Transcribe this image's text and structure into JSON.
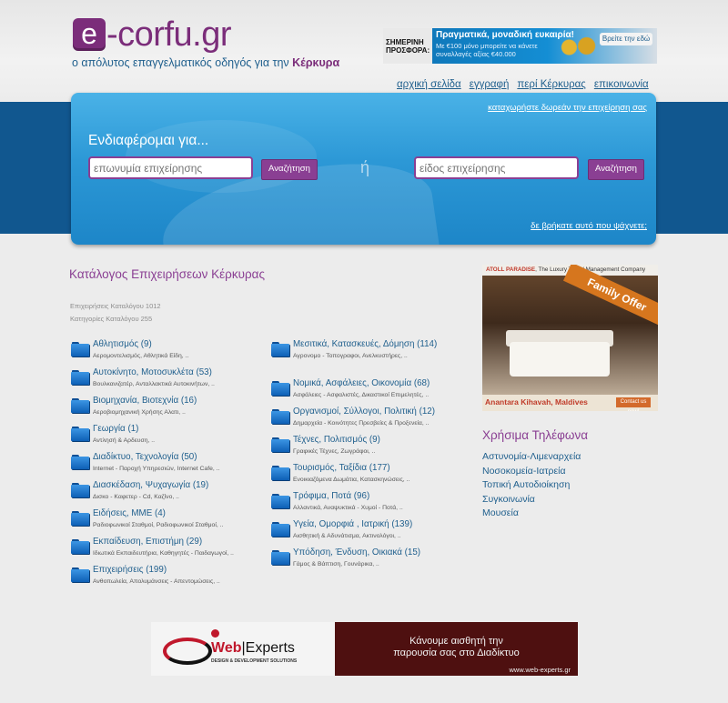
{
  "site": {
    "logo_e": "e",
    "logo_rest": "-corfu.gr",
    "tagline_prefix": "ο απόλυτος επαγγελματικός οδηγός για την ",
    "tagline_place": "Κέρκυρα"
  },
  "ad_top": {
    "label_line1": "ΣΗΜΕΡΙΝΗ",
    "label_line2": "ΠΡΟΣΦΟΡΑ:",
    "title": "Πραγματικά, μοναδική ευκαιρία!",
    "subtitle": "Με €100 μόνο μπορείτε να κάνετε συναλλαγές αξίας €40.000",
    "cta": "Βρείτε την εδώ"
  },
  "topnav": [
    "αρχική σελίδα",
    "εγγραφή",
    "περί Κέρκυρας",
    "επικοινωνία"
  ],
  "search": {
    "register_link": "καταχωρήστε δωρεάν την επιχείρηση σας",
    "heading": "Ενδιαφέρομαι για...",
    "name_placeholder": "επωνυμία επιχείρησης",
    "type_placeholder": "είδος επιχείρησης",
    "button_label": "Αναζήτηση",
    "or": "ή",
    "help_link": "δε βρήκατε αυτό που ψάχνετε;"
  },
  "catalog": {
    "title": "Κατάλογος Επιχειρήσεων Κέρκυρας",
    "stat_businesses": "Επιχειρήσεις Καταλόγου 1012",
    "stat_categories": "Κατηγορίες Καταλόγου 255",
    "left": [
      {
        "name": "Αθλητισμός (9)",
        "sub": "Αερομοντελισμός, Αθλητικά Είδη, .."
      },
      {
        "name": "Αυτοκίνητο, Μοτοσυκλέτα (53)",
        "sub": "Βουλκανιζατέρ, Ανταλλακτικά Αυτοκινήτων, .."
      },
      {
        "name": "Βιομηχανία, Βιοτεχνία (16)",
        "sub": "Αεροβιομηχανική Χρήσης Αλατι, .."
      },
      {
        "name": "Γεωργία (1)",
        "sub": "Αντλησή & Αρδευση, .."
      },
      {
        "name": "Διαδίκτυο, Τεχνολογία (50)",
        "sub": "Internet - Παροχή Υπηρεσιών, Internet Cafe, .."
      },
      {
        "name": "Διασκέδαση, Ψυχαγωγία (19)",
        "sub": "Δισκο - Καφετερ - Cd, Καζίνο, .."
      },
      {
        "name": "Ειδήσεις, ΜΜΕ (4)",
        "sub": "Ραδιοφωνικοί Σταθμοί, Ραδιοφωνικοί Σταθμοί, .."
      },
      {
        "name": "Εκπαίδευση, Επιστήμη (29)",
        "sub": "Ιδιωτικά Εκπαιδευτήρια, Καθηγητές - Παιδαγωγοί, .."
      },
      {
        "name": "Επιχειρήσεις (199)",
        "sub": "Ανθοπωλεία, Απολυμάνσεις - Απεντομώσεις, .."
      }
    ],
    "right": [
      {
        "name": "Μεσιτικά, Κατασκευές, Δόμηση (114)",
        "sub": "Αγρονομο - Τοπογραφοι, Ανελκυστήρες, .."
      },
      {
        "name": "Νομικά, Ασφάλειες, Οικονομία (68)",
        "sub": "Ασφάλειες - Ασφαλιστές, Δικαστικοί Επιμελητές, .."
      },
      {
        "name": "Οργανισμοί, Σύλλογοι, Πολιτική (12)",
        "sub": "Δημαρχεία - Κοινότητες Πρεσβείες & Προξενεία, .."
      },
      {
        "name": "Τέχνες, Πολιτισμός (9)",
        "sub": "Γραφικές Τέχνες, Ζωγράφοι, .."
      },
      {
        "name": "Τουρισμός, Ταξίδια (177)",
        "sub": "Ενοικιαζόμενα Δωμάτια, Κατασκηνώσεις, .."
      },
      {
        "name": "Τρόφιμα, Ποτά (96)",
        "sub": "Αλλαντικά, Αναψυκτικά - Χυμοί - Ποτά, .."
      },
      {
        "name": "Υγεία, Ομορφιά , Ιατρική (139)",
        "sub": "Αισθητική & Αδυνάτισμα, Ακτινολόγοι, .."
      },
      {
        "name": "Υπόδηση, Ένδυση, Οικιακά (15)",
        "sub": "Γάμος & Βάπτιση, Γουνάρικα, .."
      }
    ]
  },
  "right_ad": {
    "top_brand": "ATOLL PARADISE",
    "top_rest": ", The Luxury Travel Management Company",
    "banner": "Family Offer",
    "location": "Anantara Kihavah, Maldives",
    "cta": "Contact us now!"
  },
  "phones": {
    "title": "Χρήσιμα Τηλέφωνα",
    "items": [
      "Αστυνομία-Λιμεναρχεία",
      "Νοσοκομεία-Ιατρεία",
      "Τοπική Αυτοδιοίκηση",
      "Συγκοινωνία",
      "Μουσεία"
    ]
  },
  "bottom_ad": {
    "brand_web": "Web",
    "brand_experts": "Experts",
    "tagline": "DESIGN & DEVELOPMENT SOLUTIONS",
    "message_line1": "Κάνουμε αισθητή την",
    "message_line2": "παρουσία σας στο Διαδίκτυο",
    "url": "www.web-experts.gr"
  },
  "colors": {
    "brand_purple": "#7b2d7a",
    "link_blue": "#1f5f8d",
    "band_blue": "#11578f",
    "panel_blue": "#2c98d6"
  }
}
